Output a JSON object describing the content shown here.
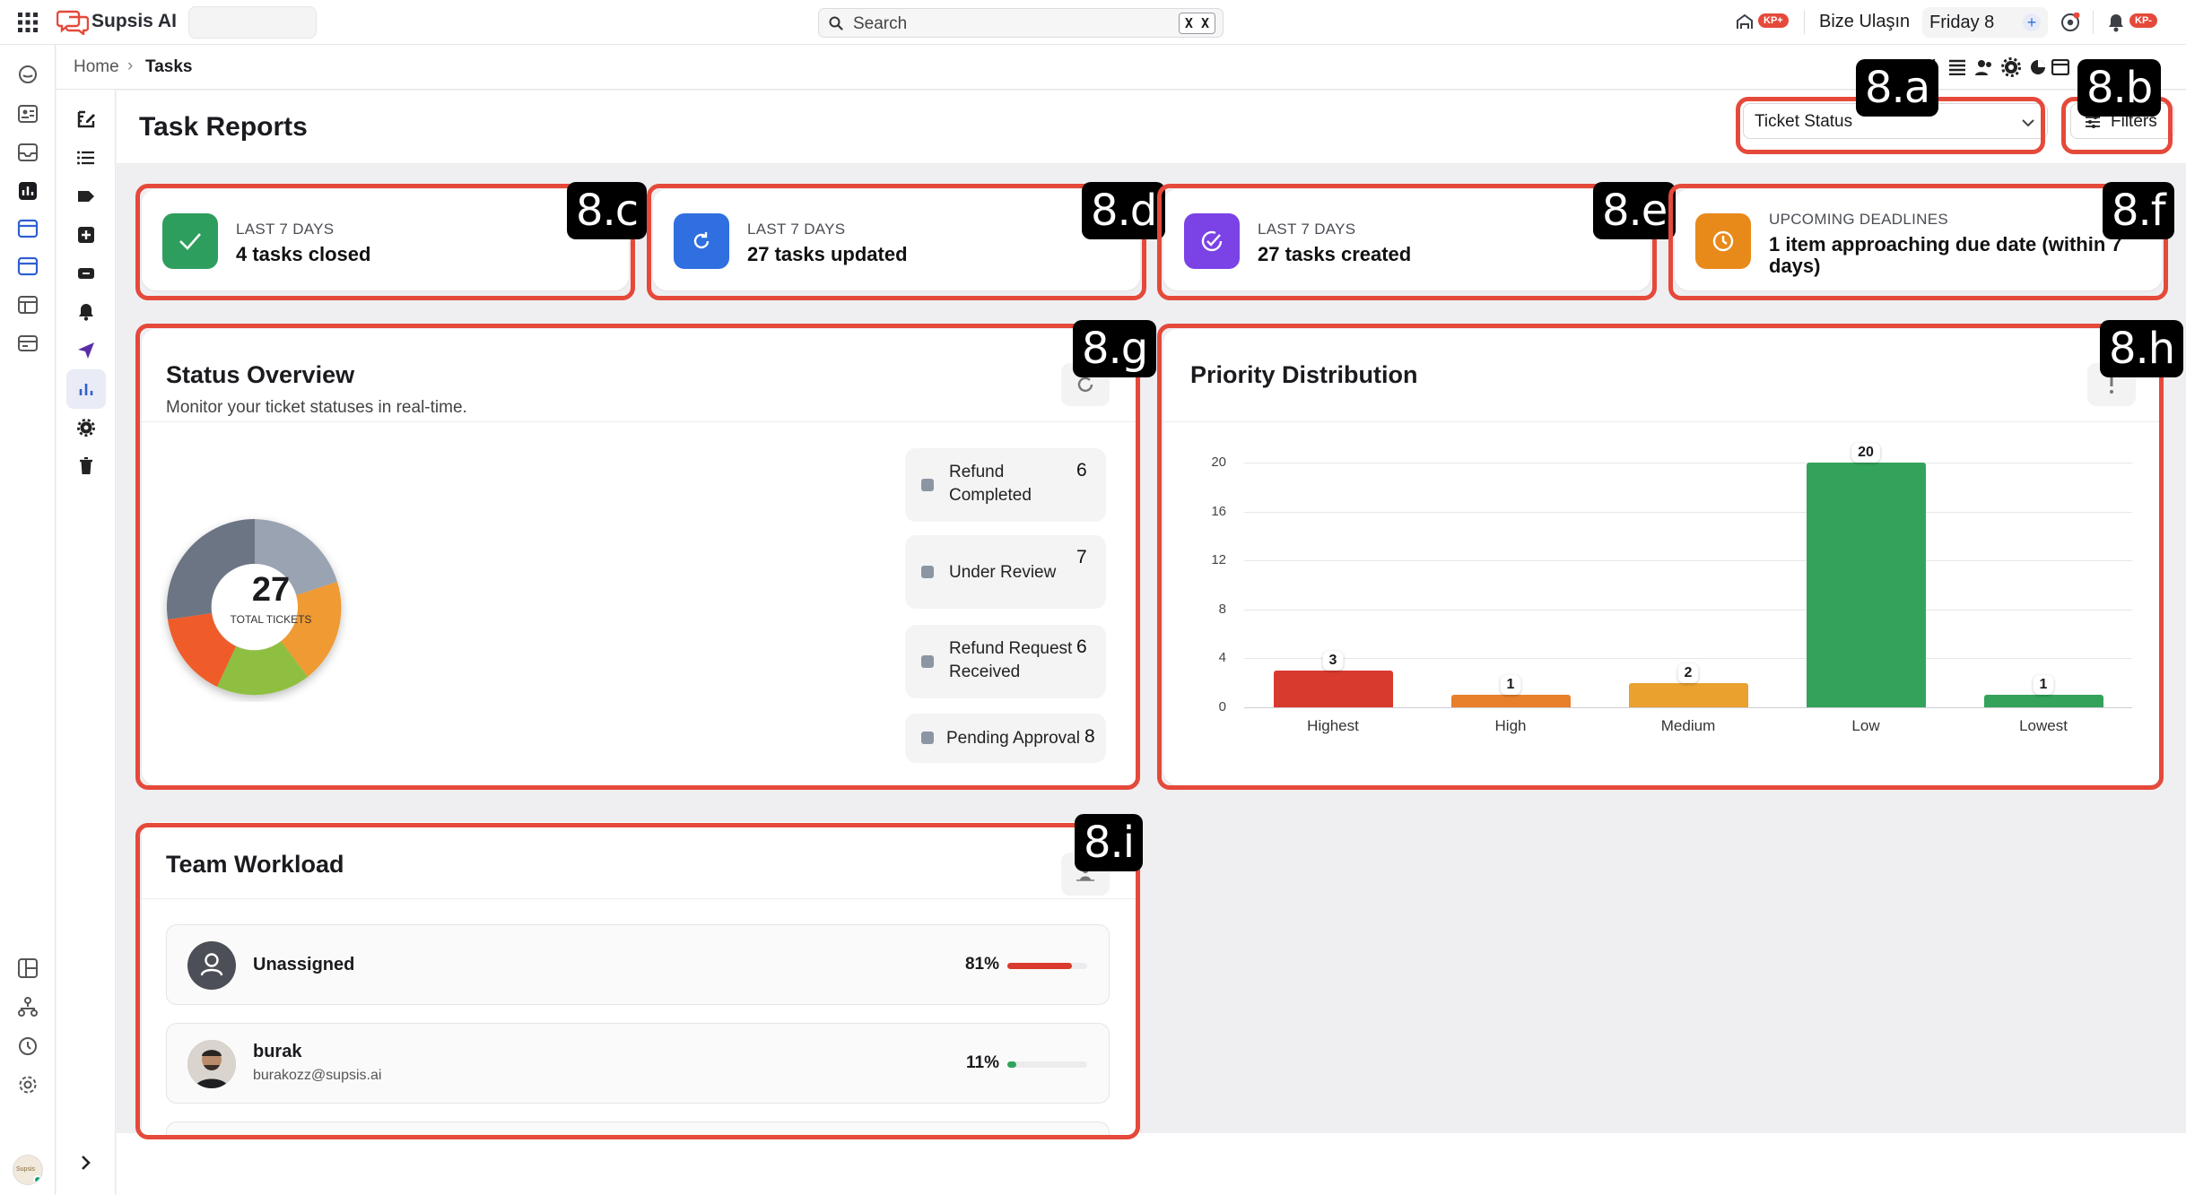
{
  "app": {
    "name": "Supsis AI"
  },
  "topbar": {
    "search_placeholder": "Search",
    "search_shortcut": "X X",
    "badge1": "KP+",
    "contact": "Bize Ulaşın",
    "date": "Friday 8",
    "badge2": "KP-"
  },
  "breadcrumb": {
    "home": "Home",
    "sep": "›",
    "current": "Tasks"
  },
  "header": {
    "title": "Task Reports",
    "select_value": "Ticket Status",
    "filters_label": "Filters"
  },
  "annotations": {
    "a": "8.a",
    "b": "8.b",
    "c": "8.c",
    "d": "8.d",
    "e": "8.e",
    "f": "8.f",
    "g": "8.g",
    "h": "8.h",
    "i": "8.i"
  },
  "stats": [
    {
      "kicker": "LAST 7 DAYS",
      "value": "4 tasks closed",
      "icon": "check-icon",
      "color": "#2e9e5e"
    },
    {
      "kicker": "LAST 7 DAYS",
      "value": "27 tasks updated",
      "icon": "refresh-icon",
      "color": "#2f6fe0"
    },
    {
      "kicker": "LAST 7 DAYS",
      "value": "27 tasks created",
      "icon": "check-circle-icon",
      "color": "#7b42e6"
    },
    {
      "kicker": "UPCOMING DEADLINES",
      "value_line1": "1 item approaching due date (within 7",
      "value_line2": "days)",
      "icon": "clock-icon",
      "color": "#e88a1a"
    }
  ],
  "status_overview": {
    "title": "Status Overview",
    "subtitle": "Monitor your ticket statuses in real-time.",
    "total": "27",
    "total_label": "TOTAL TICKETS",
    "legend": [
      {
        "l1": "Refund",
        "l2": "Completed",
        "count": "6"
      },
      {
        "l1": "Under Review",
        "count": "7"
      },
      {
        "l1": "Refund Request",
        "l2": "Received",
        "count": "6"
      },
      {
        "l1": "Pending Approval",
        "count": "8"
      }
    ]
  },
  "chart_data": {
    "type": "bar",
    "title": "Priority Distribution",
    "categories": [
      "Highest",
      "High",
      "Medium",
      "Low",
      "Lowest"
    ],
    "values": [
      3,
      1,
      2,
      20,
      1
    ],
    "colors": [
      "#d93a2e",
      "#e87f2a",
      "#eaa12e",
      "#33a35c",
      "#33a35c"
    ],
    "ylim": [
      0,
      20
    ],
    "yticks": [
      0,
      4,
      8,
      12,
      16,
      20
    ],
    "grid": true,
    "labels": [
      "3",
      "1",
      "2",
      "20",
      "1"
    ],
    "ytick_labels": [
      "0",
      "4",
      "8",
      "12",
      "16",
      "20"
    ]
  },
  "team_workload": {
    "title": "Team Workload",
    "rows": [
      {
        "name": "Unassigned",
        "email": "",
        "percent_text": "81%",
        "percent": 81,
        "color": "#d93a2e"
      },
      {
        "name": "burak",
        "email": "burakozz@supsis.ai",
        "percent_text": "11%",
        "percent": 11,
        "color": "#33a35c"
      }
    ]
  },
  "user": {
    "avatar_text": "Supsis"
  }
}
